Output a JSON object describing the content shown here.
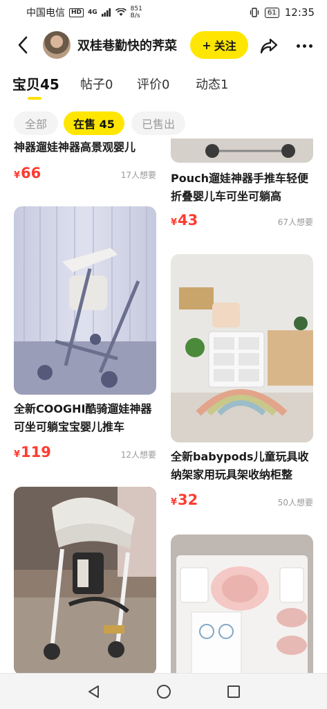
{
  "status_bar": {
    "carrier": "中国电信",
    "hd": "HD",
    "network": "4G",
    "speed_value": "851",
    "speed_unit": "B/s",
    "battery": "61",
    "time": "12:35"
  },
  "header": {
    "shop_name": "双桂巷勤快的荠菜",
    "follow_label": "关注",
    "follow_prefix": "+"
  },
  "tabs": [
    {
      "label": "宝贝",
      "count": "45"
    },
    {
      "label": "帖子",
      "count": "0"
    },
    {
      "label": "评价",
      "count": "0"
    },
    {
      "label": "动态",
      "count": "1"
    }
  ],
  "filters": [
    {
      "label": "全部"
    },
    {
      "label": "在售 45"
    },
    {
      "label": "已售出"
    }
  ],
  "items": [
    {
      "title": "神器遛娃神器高景观婴儿",
      "currency": "¥",
      "price": "66",
      "wants": "17人想要"
    },
    {
      "title": "全新COOGHI酷骑遛娃神器可坐可躺宝宝婴儿推车",
      "currency": "¥",
      "price": "119",
      "wants": "12人想要"
    },
    {
      "title": "",
      "currency": "",
      "price": "",
      "wants": ""
    },
    {
      "title": "Pouch遛娃神器手推车轻便折叠婴儿车可坐可躺高",
      "currency": "¥",
      "price": "43",
      "wants": "67人想要"
    },
    {
      "title": "全新babypods儿童玩具收纳架家用玩具架收纳柜整",
      "currency": "¥",
      "price": "32",
      "wants": "50人想要"
    },
    {
      "title": "",
      "currency": "",
      "price": "",
      "wants": ""
    }
  ],
  "colors": {
    "accent_yellow": "#ffe600",
    "price_red": "#ff3b30",
    "muted_text": "#999999"
  },
  "icons": {
    "back": "chevron-left-icon",
    "share": "share-icon",
    "more": "more-dots-icon",
    "nav_back": "triangle-back-icon",
    "nav_home": "circle-home-icon",
    "nav_recent": "square-recent-icon"
  }
}
